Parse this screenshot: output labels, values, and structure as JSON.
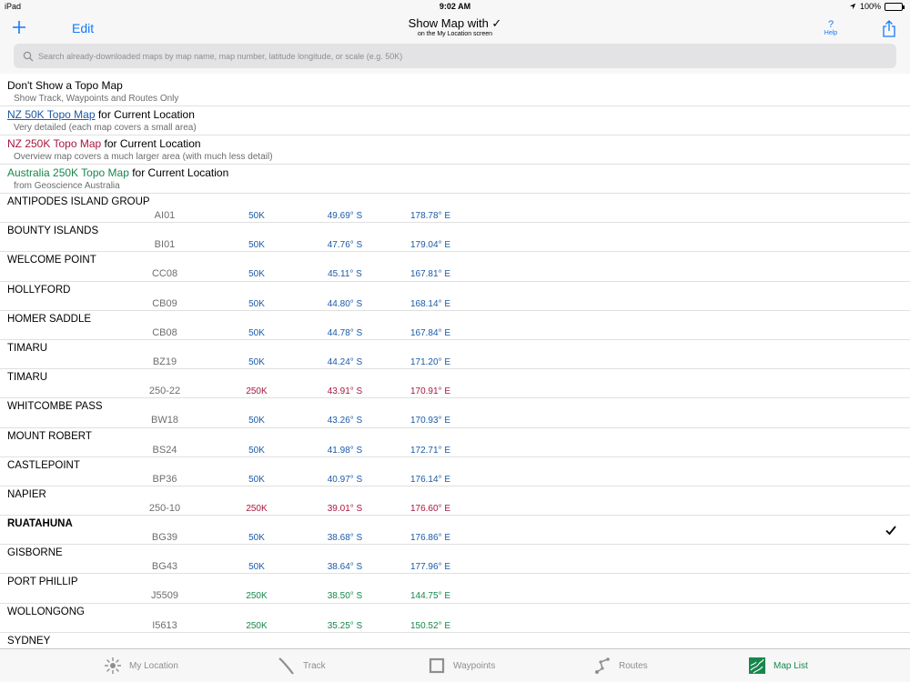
{
  "status": {
    "device": "iPad",
    "time": "9:02 AM",
    "battery": "100%"
  },
  "nav": {
    "edit": "Edit",
    "title": "Show Map with ✓",
    "subtitle": "on the My Location screen",
    "help_q": "?",
    "help_label": "Help"
  },
  "search": {
    "placeholder": "Search already-downloaded maps by map name, map number, latitude longitude, or scale (e.g. 50K)"
  },
  "options": [
    {
      "title": "Don't Show a Topo Map",
      "title_suffix": "",
      "subtitle": "Show Track, Waypoints and Routes Only"
    },
    {
      "title": "NZ 50K Topo Map",
      "title_suffix": " for Current Location",
      "subtitle": "Very detailed (each map covers a small area)"
    },
    {
      "title": "NZ 250K Topo Map",
      "title_suffix": " for Current Location",
      "subtitle": "Overview map covers a much larger area (with much less detail)"
    },
    {
      "title": "Australia 250K Topo Map",
      "title_suffix": " for Current Location",
      "subtitle": "from Geoscience Australia"
    }
  ],
  "maps": [
    {
      "name": "ANTIPODES ISLAND GROUP",
      "code": "AI01",
      "scale": "50K",
      "lat": "49.69° S",
      "lon": "178.78° E",
      "kind": "nz50"
    },
    {
      "name": "BOUNTY ISLANDS",
      "code": "BI01",
      "scale": "50K",
      "lat": "47.76° S",
      "lon": "179.04° E",
      "kind": "nz50"
    },
    {
      "name": "WELCOME POINT",
      "code": "CC08",
      "scale": "50K",
      "lat": "45.11° S",
      "lon": "167.81° E",
      "kind": "nz50"
    },
    {
      "name": "HOLLYFORD",
      "code": "CB09",
      "scale": "50K",
      "lat": "44.80° S",
      "lon": "168.14° E",
      "kind": "nz50"
    },
    {
      "name": "HOMER SADDLE",
      "code": "CB08",
      "scale": "50K",
      "lat": "44.78° S",
      "lon": "167.84° E",
      "kind": "nz50"
    },
    {
      "name": "TIMARU",
      "code": "BZ19",
      "scale": "50K",
      "lat": "44.24° S",
      "lon": "171.20° E",
      "kind": "nz50"
    },
    {
      "name": "TIMARU",
      "code": "250-22",
      "scale": "250K",
      "lat": "43.91° S",
      "lon": "170.91° E",
      "kind": "nz250"
    },
    {
      "name": "WHITCOMBE PASS",
      "code": "BW18",
      "scale": "50K",
      "lat": "43.26° S",
      "lon": "170.93° E",
      "kind": "nz50"
    },
    {
      "name": "MOUNT ROBERT",
      "code": "BS24",
      "scale": "50K",
      "lat": "41.98° S",
      "lon": "172.71° E",
      "kind": "nz50"
    },
    {
      "name": "CASTLEPOINT",
      "code": "BP36",
      "scale": "50K",
      "lat": "40.97° S",
      "lon": "176.14° E",
      "kind": "nz50"
    },
    {
      "name": "NAPIER",
      "code": "250-10",
      "scale": "250K",
      "lat": "39.01° S",
      "lon": "176.60° E",
      "kind": "nz250"
    },
    {
      "name": "RUATAHUNA",
      "code": "BG39",
      "scale": "50K",
      "lat": "38.68° S",
      "lon": "176.86° E",
      "kind": "nz50",
      "selected": true
    },
    {
      "name": "GISBORNE",
      "code": "BG43",
      "scale": "50K",
      "lat": "38.64° S",
      "lon": "177.96° E",
      "kind": "nz50"
    },
    {
      "name": "PORT PHILLIP",
      "code": "J5509",
      "scale": "250K",
      "lat": "38.50° S",
      "lon": "144.75° E",
      "kind": "au250"
    },
    {
      "name": "WOLLONGONG",
      "code": "I5613",
      "scale": "250K",
      "lat": "35.25° S",
      "lon": "150.52° E",
      "kind": "au250"
    },
    {
      "name": "SYDNEY",
      "code": "",
      "scale": "",
      "lat": "",
      "lon": "",
      "kind": "au250"
    }
  ],
  "tabs": [
    {
      "id": "my-location",
      "label": "My Location",
      "icon": "sun-icon"
    },
    {
      "id": "track",
      "label": "Track",
      "icon": "track-icon"
    },
    {
      "id": "waypoints",
      "label": "Waypoints",
      "icon": "waypoint-icon"
    },
    {
      "id": "routes",
      "label": "Routes",
      "icon": "route-icon"
    },
    {
      "id": "map-list",
      "label": "Map List",
      "icon": "map-icon",
      "active": true
    }
  ],
  "colors": {
    "accent": "#1479fb",
    "nz50": "#1b5aa8",
    "nz250": "#a8173e",
    "au250": "#17874b"
  }
}
